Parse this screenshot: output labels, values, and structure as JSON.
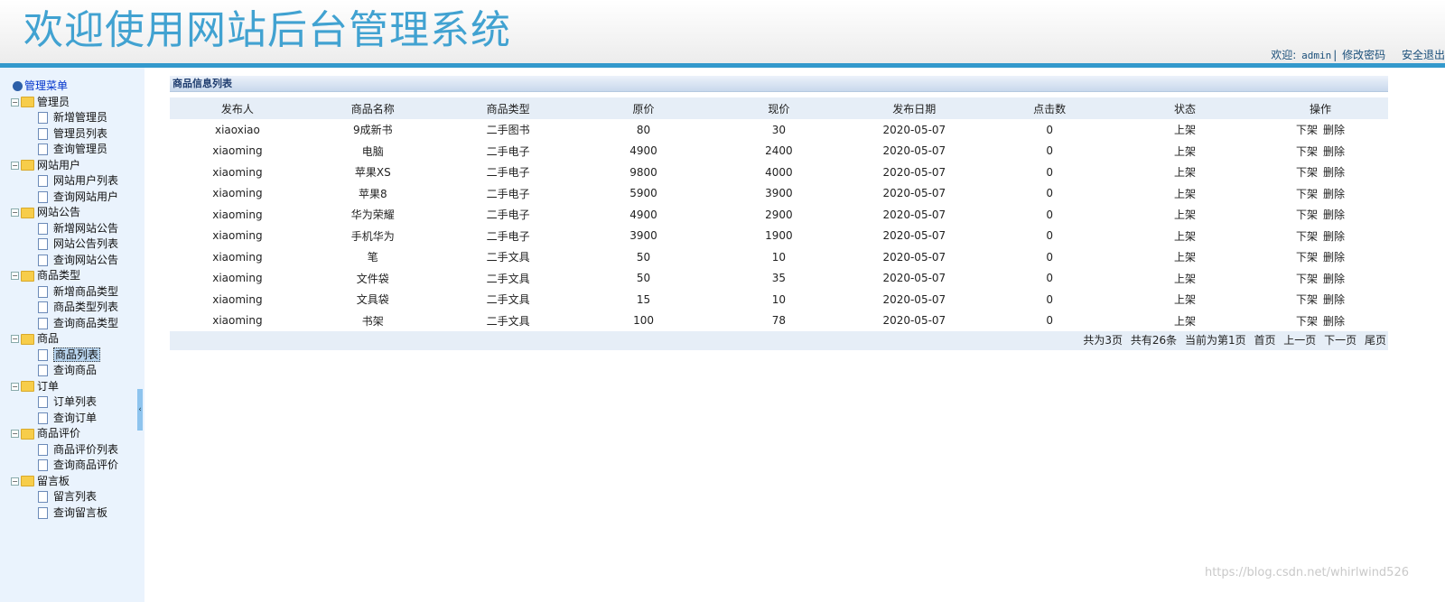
{
  "header": {
    "title": "欢迎使用网站后台管理系统",
    "welcome": "欢迎:",
    "username": "admin",
    "separator": "|",
    "change_password": "修改密码",
    "logout": "安全退出"
  },
  "sidebar": {
    "root_label": "管理菜单",
    "groups": [
      {
        "label": "管理员",
        "items": [
          "新增管理员",
          "管理员列表",
          "查询管理员"
        ]
      },
      {
        "label": "网站用户",
        "items": [
          "网站用户列表",
          "查询网站用户"
        ]
      },
      {
        "label": "网站公告",
        "items": [
          "新增网站公告",
          "网站公告列表",
          "查询网站公告"
        ]
      },
      {
        "label": "商品类型",
        "items": [
          "新增商品类型",
          "商品类型列表",
          "查询商品类型"
        ]
      },
      {
        "label": "商品",
        "items": [
          "商品列表",
          "查询商品"
        ]
      },
      {
        "label": "订单",
        "items": [
          "订单列表",
          "查询订单"
        ]
      },
      {
        "label": "商品评价",
        "items": [
          "商品评价列表",
          "查询商品评价"
        ]
      },
      {
        "label": "留言板",
        "items": [
          "留言列表",
          "查询留言板"
        ]
      }
    ],
    "active_item": "商品列表"
  },
  "main": {
    "panel_title": "商品信息列表",
    "columns": [
      "发布人",
      "商品名称",
      "商品类型",
      "原价",
      "现价",
      "发布日期",
      "点击数",
      "状态",
      "操作"
    ],
    "rows": [
      [
        "xiaoxiao",
        "9成新书",
        "二手图书",
        "80",
        "30",
        "2020-05-07",
        "0",
        "上架"
      ],
      [
        "xiaoming",
        "电脑",
        "二手电子",
        "4900",
        "2400",
        "2020-05-07",
        "0",
        "上架"
      ],
      [
        "xiaoming",
        "苹果XS",
        "二手电子",
        "9800",
        "4000",
        "2020-05-07",
        "0",
        "上架"
      ],
      [
        "xiaoming",
        "苹果8",
        "二手电子",
        "5900",
        "3900",
        "2020-05-07",
        "0",
        "上架"
      ],
      [
        "xiaoming",
        "华为荣耀",
        "二手电子",
        "4900",
        "2900",
        "2020-05-07",
        "0",
        "上架"
      ],
      [
        "xiaoming",
        "手机华为",
        "二手电子",
        "3900",
        "1900",
        "2020-05-07",
        "0",
        "上架"
      ],
      [
        "xiaoming",
        "笔",
        "二手文具",
        "50",
        "10",
        "2020-05-07",
        "0",
        "上架"
      ],
      [
        "xiaoming",
        "文件袋",
        "二手文具",
        "50",
        "35",
        "2020-05-07",
        "0",
        "上架"
      ],
      [
        "xiaoming",
        "文具袋",
        "二手文具",
        "15",
        "10",
        "2020-05-07",
        "0",
        "上架"
      ],
      [
        "xiaoming",
        "书架",
        "二手文具",
        "100",
        "78",
        "2020-05-07",
        "0",
        "上架"
      ]
    ],
    "row_actions": [
      "下架",
      "删除"
    ],
    "pager": {
      "total_pages": "共为3页",
      "total_records": "共有26条",
      "current_page": "当前为第1页",
      "first": "首页",
      "prev": "上一页",
      "next": "下一页",
      "last": "尾页"
    }
  },
  "watermark": "https://blog.csdn.net/whirlwind526"
}
